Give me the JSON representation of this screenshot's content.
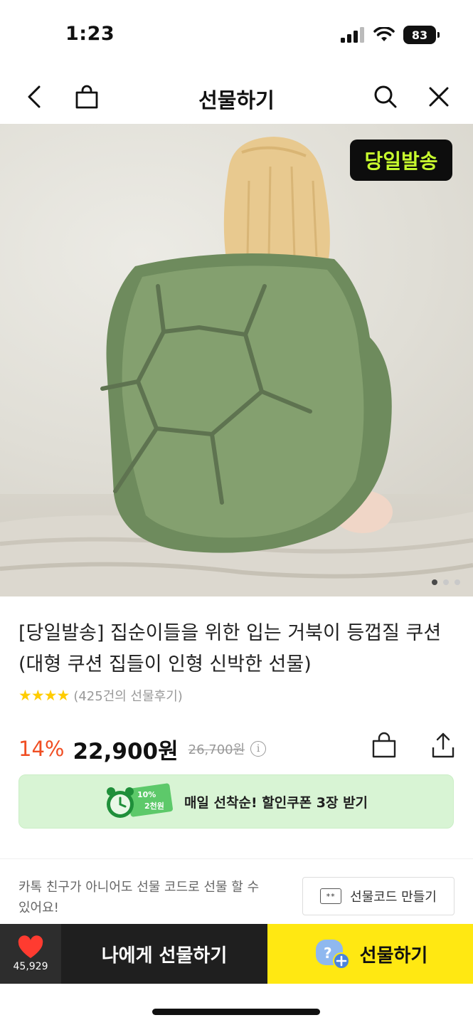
{
  "status": {
    "time": "1:23",
    "battery": "83"
  },
  "nav": {
    "title": "선물하기"
  },
  "hero": {
    "badge": "당일발송"
  },
  "product": {
    "title": "[당일발송] 집순이들을 위한 입는 거북이 등껍질 쿠션 (대형 쿠션 집들이 인형 신박한 선물)",
    "rating_stars": 4,
    "review_count": "(425건의 선물후기)",
    "discount": "14%",
    "price": "22,900원",
    "original_price": "26,700원"
  },
  "coupon": {
    "text": "매일 선착순! 할인쿠폰 3장 받기",
    "ticket_top": "10%",
    "ticket_bottom": "2천원"
  },
  "gift_code": {
    "description": "카톡 친구가 아니어도 선물 코드로 선물 할 수 있어요!",
    "button_label": "선물코드 만들기",
    "icon_text": "**"
  },
  "bottom": {
    "like_count": "45,929",
    "gift_self_label": "나에게 선물하기",
    "gift_label": "선물하기"
  },
  "colors": {
    "accent": "#ffe812",
    "discount": "#f04e23",
    "heart": "#ff3b30",
    "badge_text": "#c8ff2e"
  }
}
